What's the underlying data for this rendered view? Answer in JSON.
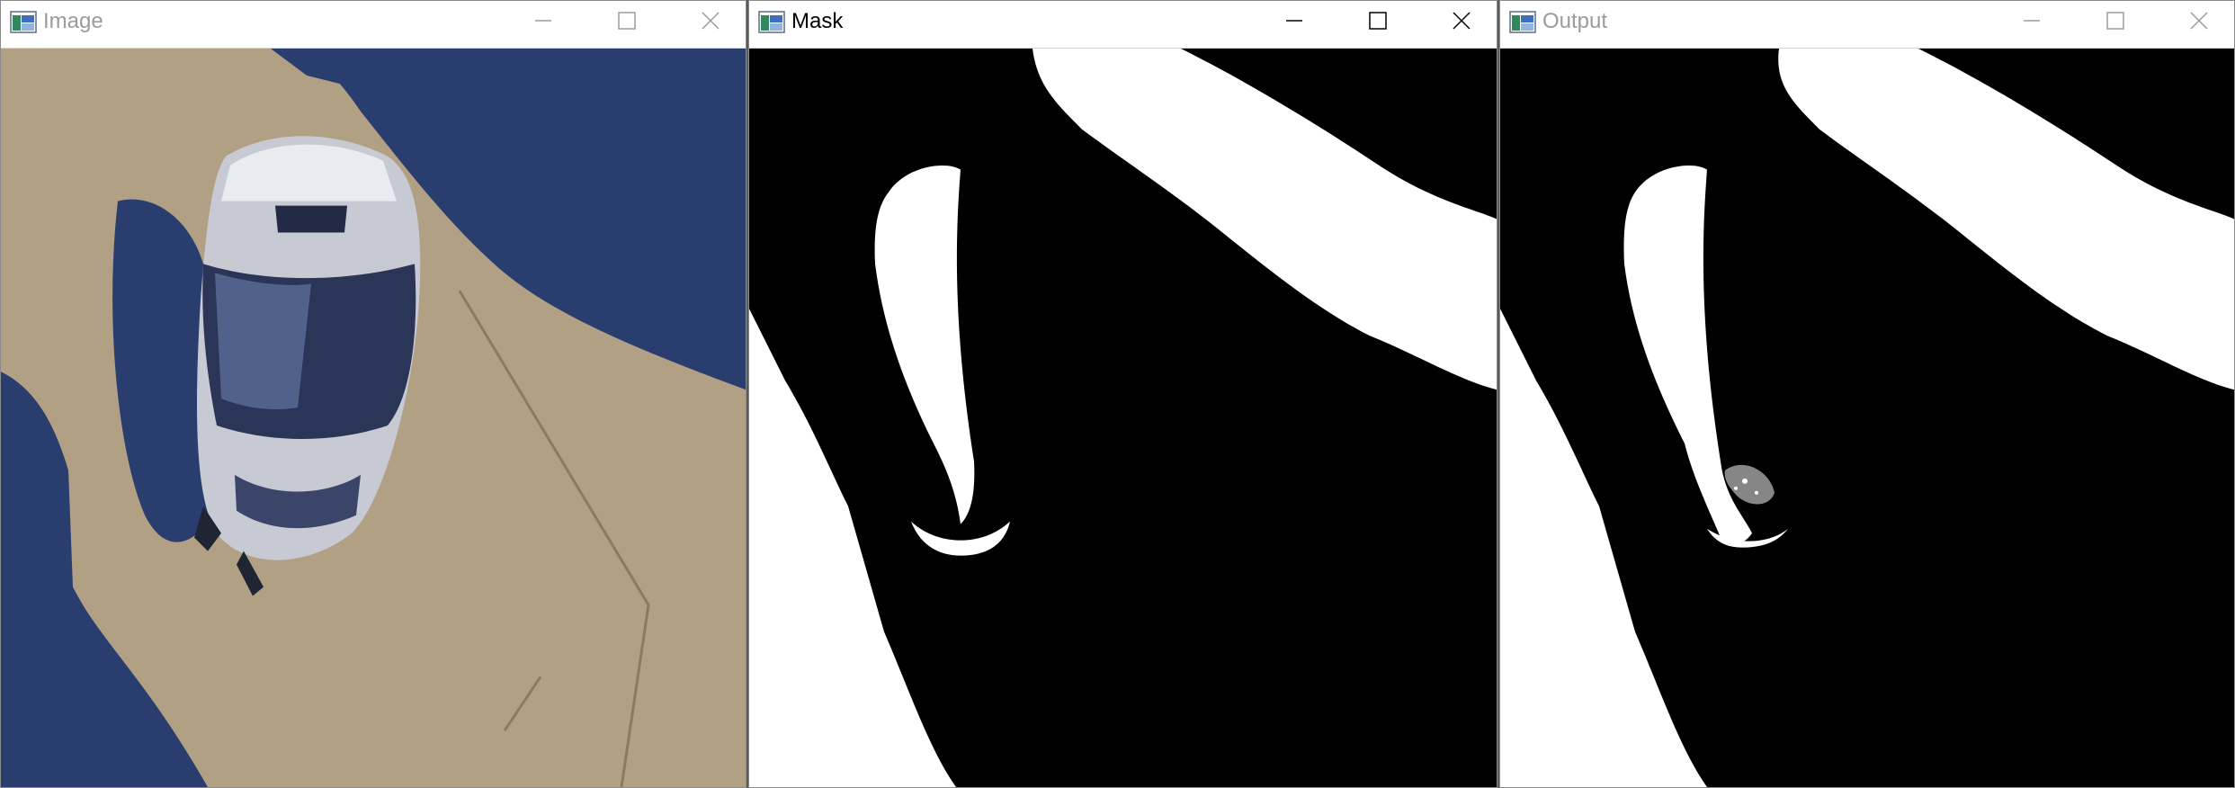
{
  "windows": [
    {
      "title": "Image",
      "active": false,
      "content": "photo of a silver motorcycle helmet with a visor resting on a sunlit concrete pavement with long shadows"
    },
    {
      "title": "Mask",
      "active": true,
      "content": "binary black and white segmentation mask"
    },
    {
      "title": "Output",
      "active": false,
      "content": "processed segmentation output"
    }
  ],
  "icons": {
    "app": "opencv-window-icon",
    "minimize": "minimize-icon",
    "maximize": "maximize-icon",
    "close": "close-icon"
  },
  "colors": {
    "inactive_title": "#9b9b9b",
    "active_title": "#000000",
    "mask_background": "#000000",
    "mask_foreground": "#ffffff",
    "pavement": "#b5a58b",
    "shadow": "#2a3d6f"
  }
}
